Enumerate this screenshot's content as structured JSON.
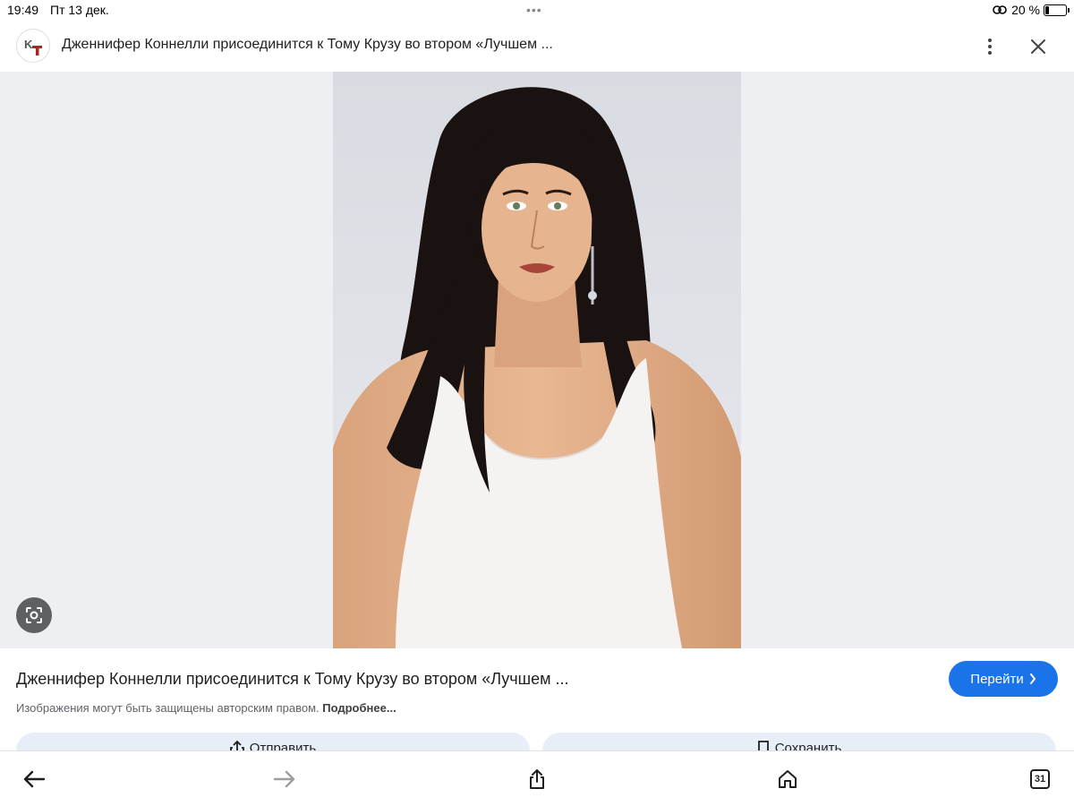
{
  "status_bar": {
    "time": "19:49",
    "date": "Пт 13 дек.",
    "dots": "•••",
    "battery_percent": "20 %",
    "battery_level": 0.2
  },
  "header": {
    "logo_icon": "kg-site-logo-icon",
    "title": "Дженнифер Коннелли присоединится к Тому Крузу во втором «Лучшем ...",
    "menu_icon": "more-vert-icon",
    "close_icon": "close-icon"
  },
  "viewer": {
    "lens_icon": "google-lens-icon",
    "background_color": "#eeeff3"
  },
  "result": {
    "title": "Дженнифер Коннелли присоединится к Тому Крузу во втором «Лучшем ...",
    "visit_label": "Перейти",
    "copyright_text": "Изображения могут быть защищены авторским правом. ",
    "more_label": "Подробнее...",
    "share_label": "Отправить",
    "save_label": "Сохранить",
    "accent_color": "#1a73e8"
  },
  "toolbar": {
    "back_icon": "arrow-left-icon",
    "forward_icon": "arrow-right-icon",
    "share_icon": "share-icon",
    "home_icon": "home-icon",
    "tabs_count": "31"
  }
}
